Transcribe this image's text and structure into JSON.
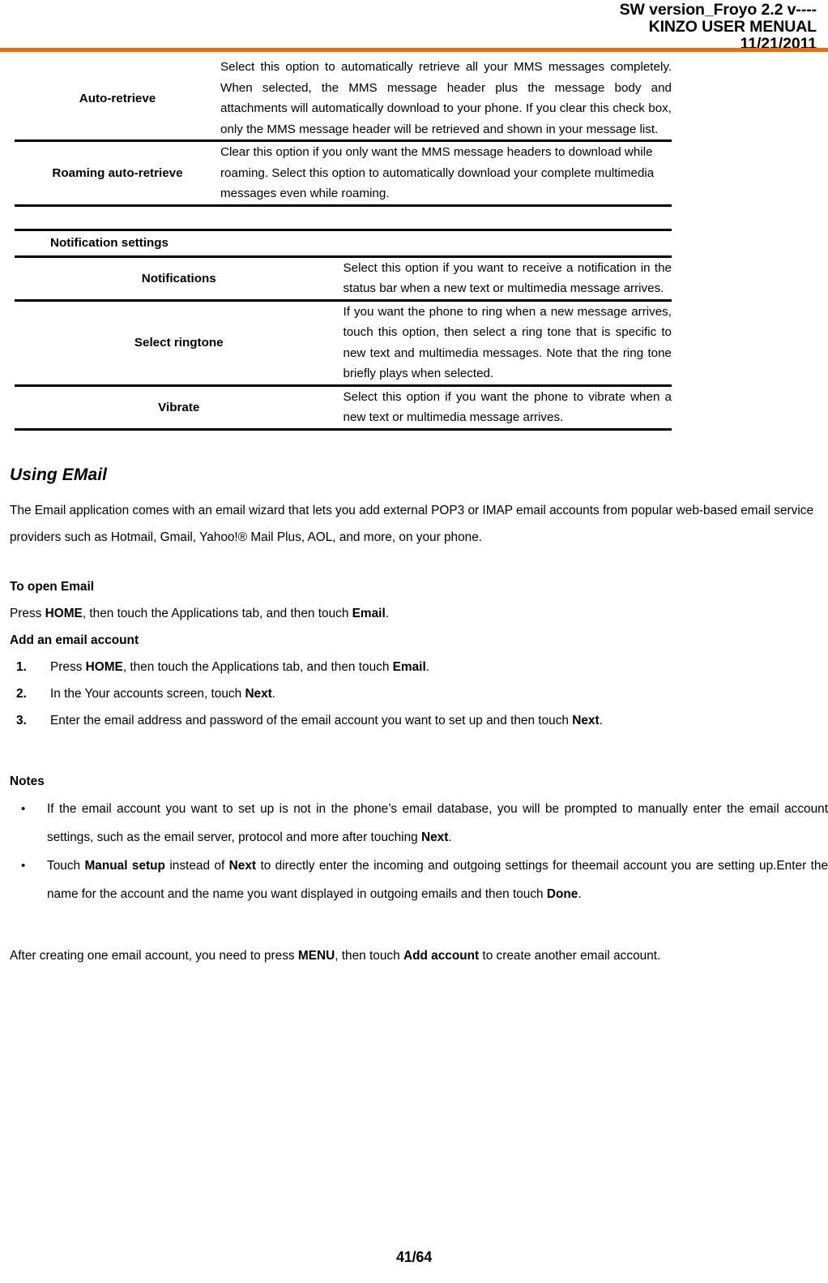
{
  "header": {
    "line1": "SW version_Froyo 2.2 v----",
    "line2": "KINZO USER MENUAL",
    "line3": "11/21/2011",
    "rule_color": "#F26A07"
  },
  "table_mms": {
    "rows": [
      {
        "label": "Auto-retrieve",
        "desc": "Select this option to automatically retrieve all your MMS messages completely. When selected, the MMS message header plus the message body and attachments will automatically download to your phone. If you clear this check box, only the MMS message header will be retrieved and shown in your message list."
      },
      {
        "label": "Roaming auto-retrieve",
        "desc": "Clear this option if you only want the MMS message headers to download while roaming. Select this option to automatically download your complete multimedia messages even while roaming."
      }
    ]
  },
  "table_notification": {
    "section_heading": "Notification settings",
    "rows": [
      {
        "label": "Notifications",
        "desc": "Select this option if you want to receive a notification in the status bar when a new text or multimedia message arrives."
      },
      {
        "label": "Select ringtone",
        "desc": "If you want the phone to ring when a new message arrives, touch this option, then select a ring tone that is specific to new text and multimedia messages. Note that the ring tone briefly plays when selected."
      },
      {
        "label": "Vibrate",
        "desc": "Select this option if you want the phone to vibrate when a new text or multimedia message arrives."
      }
    ]
  },
  "email_section": {
    "heading": "Using EMail",
    "intro": "The Email application comes with an email wizard that lets you add external POP3 or IMAP email accounts from popular web-based email service providers such as Hotmail, Gmail, Yahoo!® Mail Plus, AOL, and more, on your phone.",
    "to_open_heading": "To open Email",
    "to_open_text_1": "Press ",
    "to_open_bold_1": "HOME",
    "to_open_text_2": ", then touch the Applications tab, and then touch ",
    "to_open_bold_2": "Email",
    "to_open_text_3": ".",
    "add_account_heading": "Add an email account",
    "steps": [
      {
        "num": "1.",
        "parts": [
          {
            "t": "Press ",
            "b": false
          },
          {
            "t": "HOME",
            "b": true
          },
          {
            "t": ", then touch the Applications tab, and then touch ",
            "b": false
          },
          {
            "t": "Email",
            "b": true
          },
          {
            "t": ".",
            "b": false
          }
        ]
      },
      {
        "num": "2.",
        "parts": [
          {
            "t": "In the Your accounts screen, touch ",
            "b": false
          },
          {
            "t": "Next",
            "b": true
          },
          {
            "t": ".",
            "b": false
          }
        ]
      },
      {
        "num": "3.",
        "parts": [
          {
            "t": "Enter the email address and password of the email account you want to set up and then touch ",
            "b": false
          },
          {
            "t": "Next",
            "b": true
          },
          {
            "t": ".",
            "b": false
          }
        ]
      }
    ],
    "notes_heading": "Notes",
    "notes": [
      {
        "bullet": "•",
        "parts": [
          {
            "t": "If the email account you want to set up is not in the phone’s email database, you will be prompted to manually enter the email account settings, such as the email server, protocol and more after touching ",
            "b": false
          },
          {
            "t": "Next",
            "b": true
          },
          {
            "t": ".",
            "b": false
          }
        ]
      },
      {
        "bullet": "•",
        "parts": [
          {
            "t": "Touch ",
            "b": false
          },
          {
            "t": "Manual setup",
            "b": true
          },
          {
            "t": " instead of ",
            "b": false
          },
          {
            "t": "Next",
            "b": true
          },
          {
            "t": " to directly enter the incoming and outgoing settings for theemail account you are setting up.Enter the name for the account and the name you want displayed in outgoing emails and then touch ",
            "b": false
          },
          {
            "t": "Done",
            "b": true
          },
          {
            "t": ".",
            "b": false
          }
        ]
      }
    ],
    "closing": [
      {
        "t": "After creating one email account, you need to press ",
        "b": false
      },
      {
        "t": "MENU",
        "b": true
      },
      {
        "t": ", then touch ",
        "b": false
      },
      {
        "t": "Add account",
        "b": true
      },
      {
        "t": " to create another email account.",
        "b": false
      }
    ]
  },
  "footer": {
    "page_number": "41/64"
  }
}
